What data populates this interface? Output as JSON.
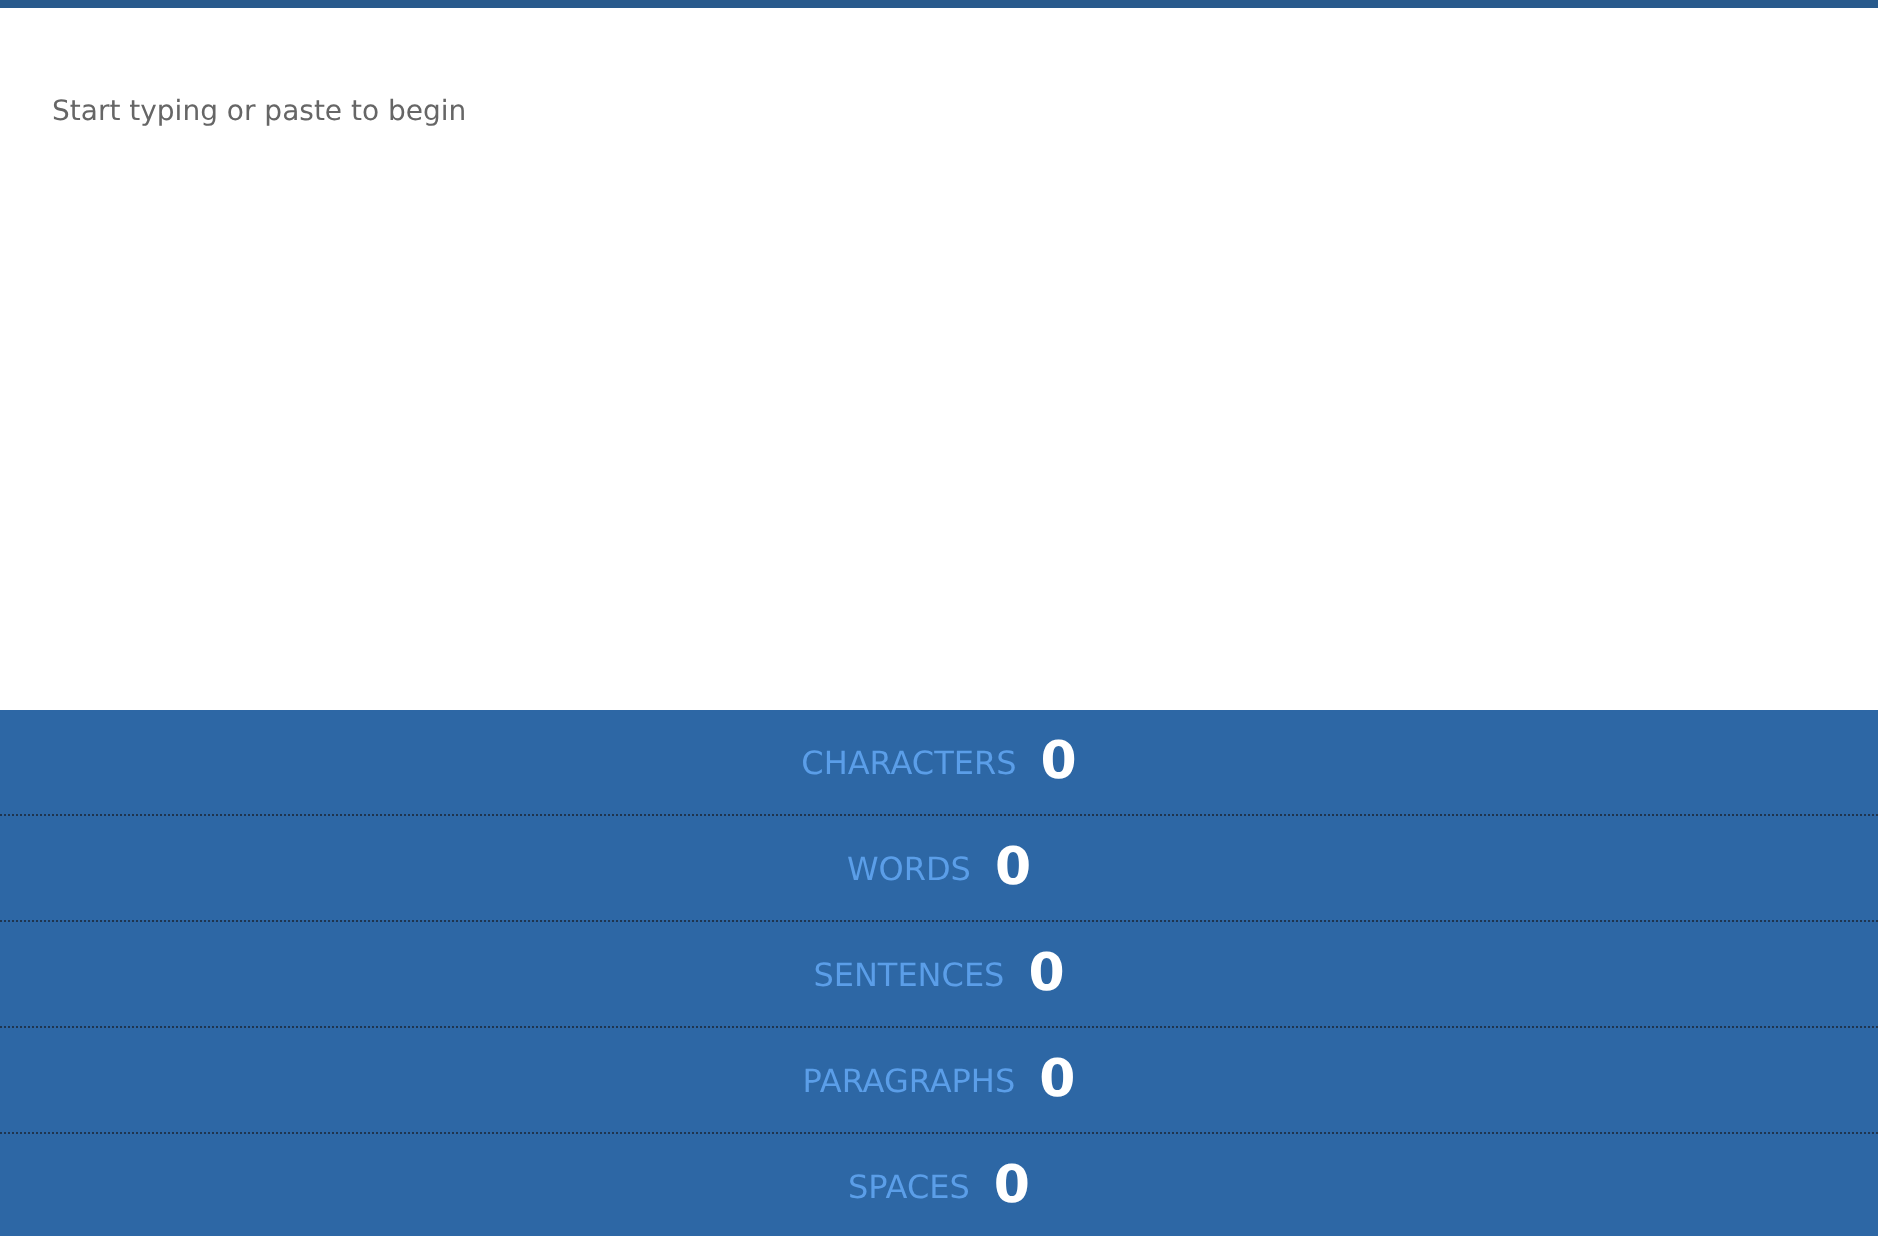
{
  "editor": {
    "placeholder": "Start typing or paste to begin"
  },
  "stats": [
    {
      "label": "CHARACTERS",
      "value": "0"
    },
    {
      "label": "WORDS",
      "value": "0"
    },
    {
      "label": "SENTENCES",
      "value": "0"
    },
    {
      "label": "PARAGRAPHS",
      "value": "0"
    },
    {
      "label": "SPACES",
      "value": "0"
    }
  ]
}
